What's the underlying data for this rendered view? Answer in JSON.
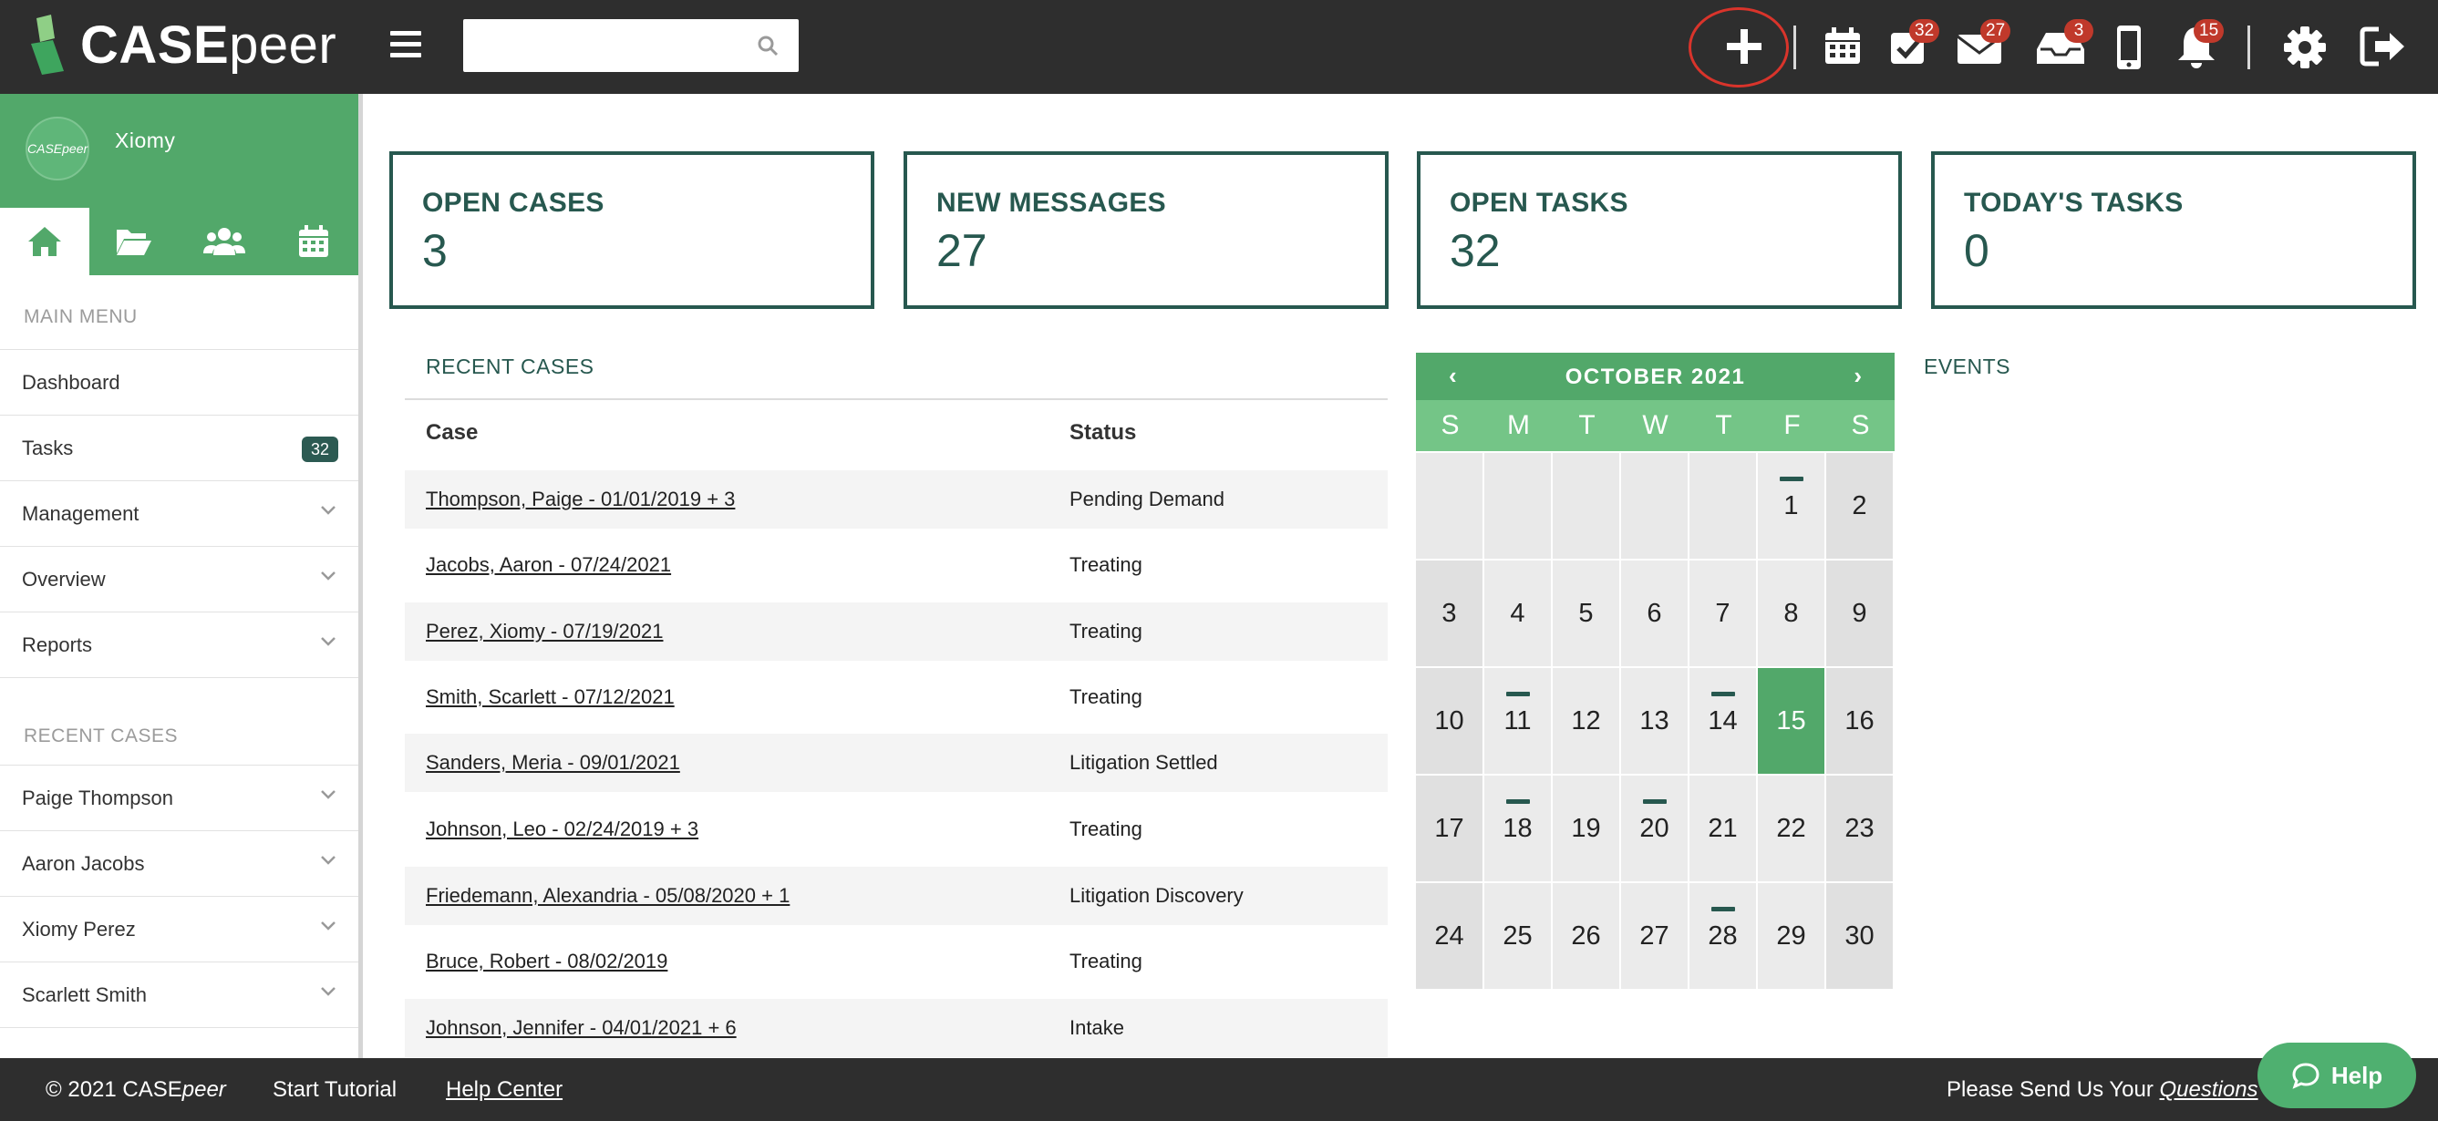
{
  "app": {
    "logo_text_bold": "CASE",
    "logo_text_thin": "peer"
  },
  "topbar": {
    "search": {
      "placeholder": "",
      "value": ""
    },
    "badges": {
      "tasks": "32",
      "messages": "27",
      "inbox": "3",
      "notifications": "15"
    },
    "icons": [
      "plus-icon",
      "calendar-icon",
      "tasks-icon",
      "mail-icon",
      "inbox-icon",
      "mobile-icon",
      "bell-icon",
      "gear-icon",
      "logout-icon"
    ]
  },
  "sidebar": {
    "username": "Xiomy",
    "avatar_text": "CASEpeer",
    "tabs": [
      "home-icon",
      "folder-icon",
      "users-icon",
      "calendar-icon"
    ],
    "main_menu_label": "MAIN MENU",
    "main_menu": [
      {
        "label": "Dashboard"
      },
      {
        "label": "Tasks",
        "count": "32"
      },
      {
        "label": "Management"
      },
      {
        "label": "Overview"
      },
      {
        "label": "Reports"
      }
    ],
    "recent_label": "RECENT CASES",
    "recent": [
      {
        "label": "Paige Thompson"
      },
      {
        "label": "Aaron Jacobs"
      },
      {
        "label": "Xiomy Perez"
      },
      {
        "label": "Scarlett Smith"
      }
    ]
  },
  "cards": [
    {
      "label": "OPEN CASES",
      "value": "3"
    },
    {
      "label": "NEW MESSAGES",
      "value": "27"
    },
    {
      "label": "OPEN TASKS",
      "value": "32"
    },
    {
      "label": "TODAY'S TASKS",
      "value": "0"
    }
  ],
  "recent_cases": {
    "title": "RECENT CASES",
    "columns": [
      "Case",
      "Status"
    ],
    "rows": [
      {
        "case": "Thompson, Paige - 01/01/2019 + 3",
        "status": "Pending Demand"
      },
      {
        "case": "Jacobs, Aaron - 07/24/2021",
        "status": "Treating"
      },
      {
        "case": "Perez, Xiomy - 07/19/2021",
        "status": "Treating"
      },
      {
        "case": "Smith, Scarlett - 07/12/2021",
        "status": "Treating"
      },
      {
        "case": "Sanders, Meria - 09/01/2021",
        "status": "Litigation Settled"
      },
      {
        "case": "Johnson, Leo - 02/24/2019 + 3",
        "status": "Treating"
      },
      {
        "case": "Friedemann, Alexandria - 05/08/2020 + 1",
        "status": "Litigation Discovery"
      },
      {
        "case": "Bruce, Robert - 08/02/2019",
        "status": "Treating"
      },
      {
        "case": "Johnson, Jennifer - 04/01/2021 + 6",
        "status": "Intake"
      }
    ]
  },
  "calendar": {
    "title": "OCTOBER 2021",
    "prev": "‹",
    "next": "›",
    "weekdays": [
      "S",
      "M",
      "T",
      "W",
      "T",
      "F",
      "S"
    ],
    "leading_blanks": 5,
    "days_in_month": 30,
    "today": 15,
    "event_days": [
      1,
      11,
      14,
      18,
      20,
      28
    ]
  },
  "events_title": "EVENTS",
  "footer": {
    "copyright_pre": "© 2021 CASE",
    "copyright_italic": "peer",
    "tutorial": "Start Tutorial",
    "help_center": "Help Center",
    "please_send": "Please Send Us Your ",
    "questions": "Questions"
  },
  "help_button": "Help"
}
